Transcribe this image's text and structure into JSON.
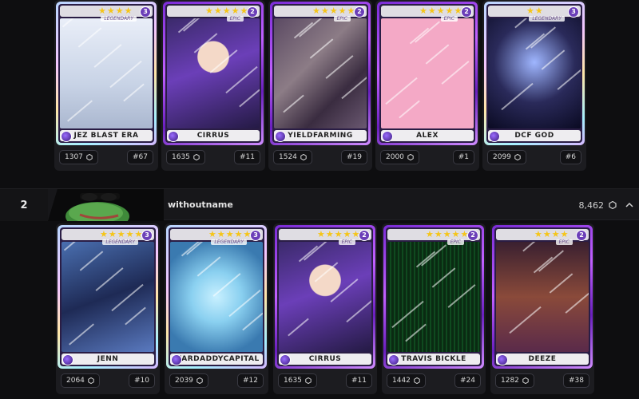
{
  "groups": [
    {
      "rank": "",
      "username": "",
      "score": "",
      "cards": [
        {
          "name": "JEZ BLAST ERA",
          "rarity": "legendary",
          "rarity_label": "LEGENDARY",
          "tier": "3",
          "stars": 4,
          "price": "1307",
          "serial": "#67",
          "art": "art-jez"
        },
        {
          "name": "CIRRUS",
          "rarity": "epic",
          "rarity_label": "EPIC",
          "tier": "2",
          "stars": 6,
          "price": "1635",
          "serial": "#11",
          "art": "art-cirrus"
        },
        {
          "name": "YIELDFARMING",
          "rarity": "epic",
          "rarity_label": "EPIC",
          "tier": "2",
          "stars": 6,
          "price": "1524",
          "serial": "#19",
          "art": "art-yield"
        },
        {
          "name": "ALEX",
          "rarity": "epic",
          "rarity_label": "EPIC",
          "tier": "2",
          "stars": 6,
          "price": "2000",
          "serial": "#1",
          "art": "art-alex"
        },
        {
          "name": "DCF GOD",
          "rarity": "legendary",
          "rarity_label": "LEGENDARY",
          "tier": "3",
          "stars": 2,
          "price": "2099",
          "serial": "#6",
          "art": "art-dcf"
        }
      ]
    },
    {
      "rank": "2",
      "username": "withoutname",
      "score": "8,462",
      "cards": [
        {
          "name": "JENN",
          "rarity": "legendary",
          "rarity_label": "LEGENDARY",
          "tier": "3",
          "stars": 5,
          "price": "2064",
          "serial": "#10",
          "art": "art-jenn"
        },
        {
          "name": "WARDADDYCAPITAL",
          "rarity": "legendary",
          "rarity_label": "LEGENDARY",
          "tier": "3",
          "stars": 5,
          "price": "2039",
          "serial": "#12",
          "art": "art-ward"
        },
        {
          "name": "CIRRUS",
          "rarity": "epic",
          "rarity_label": "EPIC",
          "tier": "2",
          "stars": 6,
          "price": "1635",
          "serial": "#11",
          "art": "art-cirrus"
        },
        {
          "name": "TRAVIS BICKLE",
          "rarity": "epic",
          "rarity_label": "EPIC",
          "tier": "2",
          "stars": 5,
          "price": "1442",
          "serial": "#24",
          "art": "art-travis"
        },
        {
          "name": "DEEZE",
          "rarity": "epic",
          "rarity_label": "EPIC",
          "tier": "2",
          "stars": 4,
          "price": "1282",
          "serial": "#38",
          "art": "art-deeze"
        }
      ]
    }
  ],
  "icons": {
    "price": "hexagon-icon",
    "score": "hexagon-icon",
    "expand": "chevron-up-icon",
    "chain": "chain-logo-icon",
    "star": "star-icon"
  },
  "colors": {
    "background": "#0e0e10",
    "star": "#f5c518",
    "epic": "#7a2bd6",
    "legendary_sheen": "#b9d6ff"
  }
}
